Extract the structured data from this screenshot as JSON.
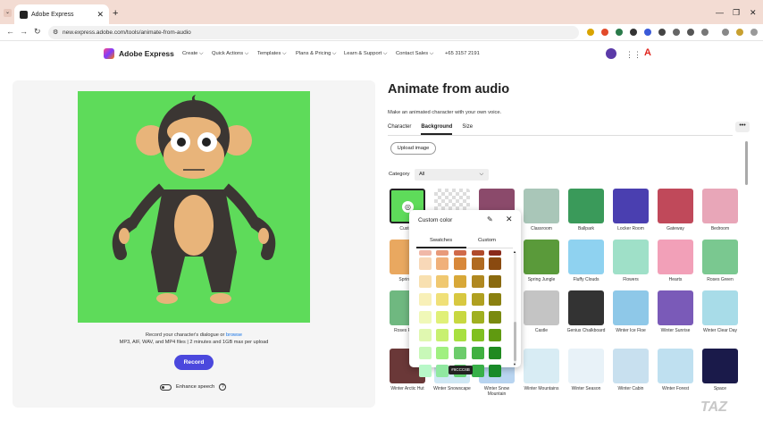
{
  "browser": {
    "tab_title": "Adobe Express",
    "url": "new.express.adobe.com/tools/animate-from-audio",
    "newtab": "+",
    "tab_close": "✕",
    "minimize": "—",
    "maximize": "❐",
    "close": "✕",
    "dropdown": "⌄",
    "back": "←",
    "forward": "→",
    "reload": "↻"
  },
  "nav": {
    "brand": "Adobe Express",
    "items": [
      "Create ⌵",
      "Quick Actions ⌵",
      "Templates ⌵",
      "Plans & Pricing ⌵",
      "Learn & Support ⌵",
      "Contact Sales ⌵",
      "+65 3157 2191"
    ],
    "adobe_mark": "A"
  },
  "left": {
    "record_line1_a": "Record your character's dialogue or ",
    "record_line1_link": "browse",
    "record_line2": "MP3, AIF, WAV, and MP4 files | 2 minutes and 1GB max per upload",
    "record_button": "Record",
    "enhance_label": "Enhance speech",
    "info": "?"
  },
  "right": {
    "title": "Animate from audio",
    "subtitle": "Make an animated character with your own voice.",
    "tabs": [
      "Character",
      "Background",
      "Size"
    ],
    "more": "•••",
    "upload": "Upload image",
    "category_label": "Category",
    "category_value": "All",
    "chev": "⌵"
  },
  "thumbs": [
    {
      "label": "Custom",
      "color": "#5edb5a"
    },
    {
      "label": "",
      "color": "#ddd"
    },
    {
      "label": "",
      "color": "#8b4a6b"
    },
    {
      "label": "Classroom",
      "color": "#a9c6b8"
    },
    {
      "label": "Ballpark",
      "color": "#3a9a5a"
    },
    {
      "label": "Locker Room",
      "color": "#4a3fb0"
    },
    {
      "label": "Gateway",
      "color": "#c0495a"
    },
    {
      "label": "Bedroom",
      "color": "#e8a6b8"
    },
    {
      "label": "Spring S",
      "color": "#e9a860"
    },
    {
      "label": "",
      "color": "#fff"
    },
    {
      "label": "",
      "color": "#fff"
    },
    {
      "label": "Spring Jungle",
      "color": "#5a9a3a"
    },
    {
      "label": "Fluffy Clouds",
      "color": "#8fd2f0"
    },
    {
      "label": "Flowers",
      "color": "#9fe0c8"
    },
    {
      "label": "Hearts",
      "color": "#f2a0b8"
    },
    {
      "label": "Roses Green",
      "color": "#7ac890"
    },
    {
      "label": "Roses Pi Gre",
      "color": "#6fb880"
    },
    {
      "label": "",
      "color": "#fff"
    },
    {
      "label": "",
      "color": "#fff"
    },
    {
      "label": "Castle",
      "color": "#c4c4c4"
    },
    {
      "label": "Genius Chalkboard",
      "color": "#333"
    },
    {
      "label": "Winter Ice Floe",
      "color": "#8ec8e8"
    },
    {
      "label": "Winter Sunrise",
      "color": "#7a5ab8"
    },
    {
      "label": "Winter Clear Day",
      "color": "#a8dce8"
    },
    {
      "label": "Winter Arctic Hut",
      "color": "#6a3838"
    },
    {
      "label": "Winter Snowscape",
      "color": "#cfe8f4"
    },
    {
      "label": "Winter Snow Mountain",
      "color": "#b8d4f0"
    },
    {
      "label": "Winter Mountains",
      "color": "#d8ecf4"
    },
    {
      "label": "Winter Season",
      "color": "#e8f2f8"
    },
    {
      "label": "Winter Cabin",
      "color": "#c8e0ef"
    },
    {
      "label": "Winter Forest",
      "color": "#bfe0f0"
    },
    {
      "label": "Space",
      "color": "#1a1a4a"
    }
  ],
  "popover": {
    "title": "Custom color",
    "eyedropper": "✎",
    "close": "✕",
    "tab_swatches": "Swatches",
    "tab_custom": "Custom",
    "tooltip": "#6CCC6B",
    "scroll_up": "▲",
    "scroll_down": "▼",
    "swatches": [
      [
        "#f0b8a8",
        "#e89a7a",
        "#d06a4a",
        "#b04a2a",
        "#8a2a1a"
      ],
      [
        "#f8d8b8",
        "#f0b07a",
        "#d8883a",
        "#b06a20",
        "#8a4a10"
      ],
      [
        "#f8e0b0",
        "#f0c870",
        "#d8a838",
        "#b08820",
        "#8a6a10"
      ],
      [
        "#f8f0b8",
        "#f0e078",
        "#d8c840",
        "#b0a020",
        "#8a8010"
      ],
      [
        "#f0f8b8",
        "#e0f078",
        "#c8d840",
        "#a0b020",
        "#7a8a10"
      ],
      [
        "#e0f8b0",
        "#c8f070",
        "#a8e040",
        "#80c020",
        "#609a10"
      ],
      [
        "#c8f8b8",
        "#a0f080",
        "#6ccc6b",
        "#40b040",
        "#208a20"
      ],
      [
        "#b8f8c8",
        "#90e8a0",
        "#60d070",
        "#38b048",
        "#188a28"
      ]
    ]
  }
}
